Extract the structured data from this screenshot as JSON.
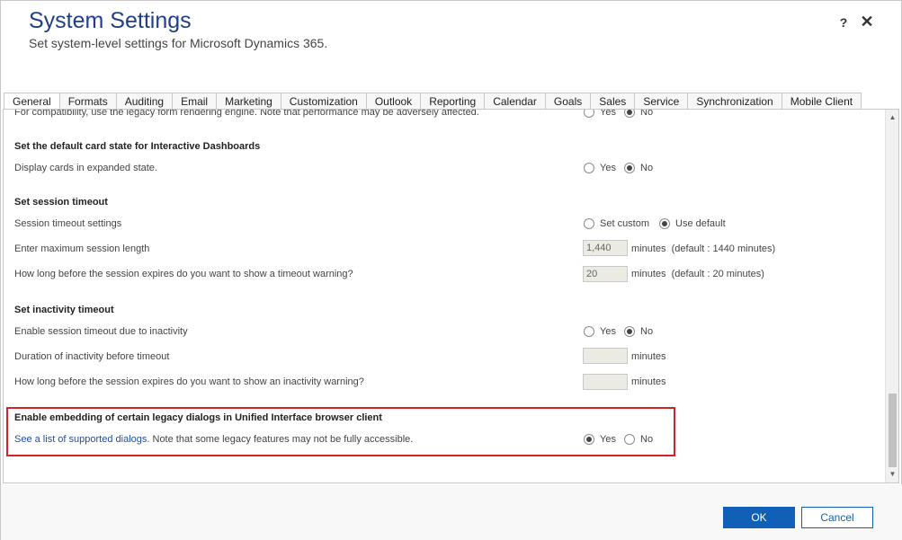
{
  "header": {
    "title": "System Settings",
    "subtitle": "Set system-level settings for Microsoft Dynamics 365.",
    "help_glyph": "?",
    "close_glyph": "✕"
  },
  "tabs": [
    {
      "label": "General",
      "active": true
    },
    {
      "label": "Formats"
    },
    {
      "label": "Auditing"
    },
    {
      "label": "Email"
    },
    {
      "label": "Marketing"
    },
    {
      "label": "Customization"
    },
    {
      "label": "Outlook"
    },
    {
      "label": "Reporting"
    },
    {
      "label": "Calendar"
    },
    {
      "label": "Goals"
    },
    {
      "label": "Sales"
    },
    {
      "label": "Service"
    },
    {
      "label": "Synchronization"
    },
    {
      "label": "Mobile Client"
    }
  ],
  "content": {
    "legacy_form_row": {
      "label": "For compatibility, use the legacy form rendering engine. Note that performance may be adversely affected.",
      "yes": "Yes",
      "no": "No",
      "selected": "No"
    },
    "card_state": {
      "title": "Set the default card state for Interactive Dashboards",
      "label": "Display cards in expanded state.",
      "yes": "Yes",
      "no": "No",
      "selected": "No"
    },
    "session_timeout": {
      "title": "Set session timeout",
      "settings_label": "Session timeout settings",
      "set_custom": "Set custom",
      "use_default": "Use default",
      "selected": "Use default",
      "max_length_label": "Enter maximum session length",
      "max_length_value": "1,440",
      "max_length_unit": "minutes",
      "max_length_default": "(default : 1440 minutes)",
      "warning_label": "How long before the session expires do you want to show a timeout warning?",
      "warning_value": "20",
      "warning_unit": "minutes",
      "warning_default": "(default : 20 minutes)"
    },
    "inactivity_timeout": {
      "title": "Set inactivity timeout",
      "enable_label": "Enable session timeout due to inactivity",
      "yes": "Yes",
      "no": "No",
      "selected": "No",
      "duration_label": "Duration of inactivity before timeout",
      "duration_value": "",
      "duration_unit": "minutes",
      "warning_label": "How long before the session expires do you want to show an inactivity warning?",
      "warning_value": "",
      "warning_unit": "minutes"
    },
    "legacy_dialogs": {
      "title": "Enable embedding of certain legacy dialogs in Unified Interface browser client",
      "link_text": "See a list of supported dialogs.",
      "note": " Note that some legacy features may not be fully accessible.",
      "yes": "Yes",
      "no": "No",
      "selected": "Yes"
    }
  },
  "scrollbar": {
    "up_glyph": "▲",
    "down_glyph": "▼"
  },
  "footer": {
    "ok_label": "OK",
    "cancel_label": "Cancel"
  },
  "colors": {
    "title": "#1f3f8a",
    "accent": "#1160b7",
    "highlight_border": "#d0232a",
    "link": "#1f4e9c"
  }
}
